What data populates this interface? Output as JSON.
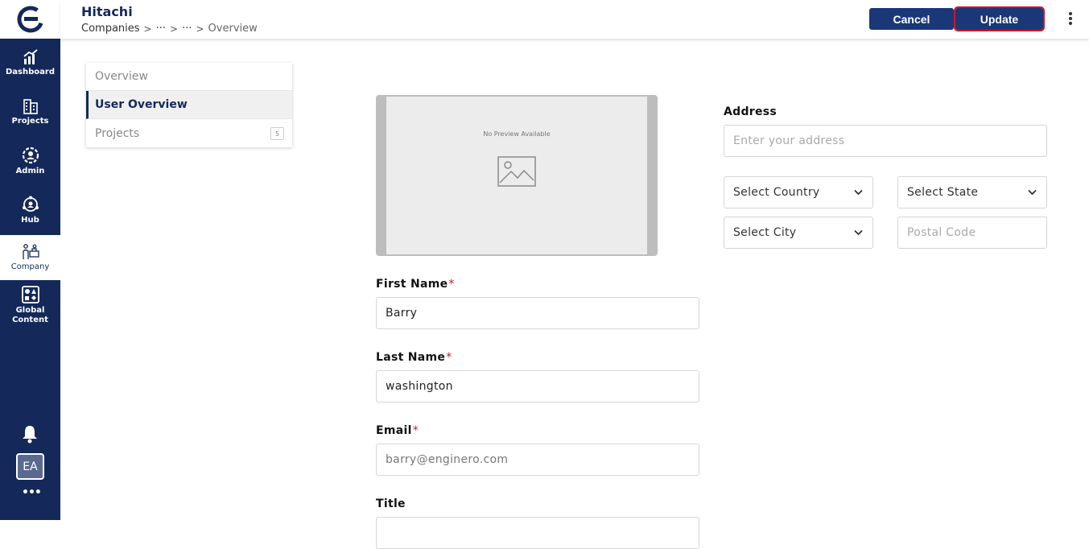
{
  "sidebar": {
    "items": [
      {
        "label": "Dashboard",
        "icon": "chart-icon"
      },
      {
        "label": "Projects",
        "icon": "building-icon"
      },
      {
        "label": "Admin",
        "icon": "admin-gear-icon"
      },
      {
        "label": "Hub",
        "icon": "hub-icon"
      },
      {
        "label": "Company",
        "icon": "company-people-icon"
      },
      {
        "label": "Global Content",
        "icon": "shapes-icon"
      }
    ],
    "avatar_initials": "EA",
    "more": "•••"
  },
  "header": {
    "title": "Hitachi",
    "breadcrumb": [
      "Companies",
      "···",
      "···",
      "Overview"
    ],
    "separator": ">",
    "cancel_label": "Cancel",
    "update_label": "Update"
  },
  "subnav": {
    "items": [
      {
        "label": "Overview"
      },
      {
        "label": "User Overview"
      },
      {
        "label": "Projects",
        "badge": "5"
      }
    ]
  },
  "preview": {
    "text": "No Preview Available"
  },
  "form": {
    "first_name": {
      "label": "First Name",
      "required": "*",
      "value": "Barry"
    },
    "last_name": {
      "label": "Last Name",
      "required": "*",
      "value": "washington"
    },
    "email": {
      "label": "Email",
      "required": "*",
      "value": "barry@enginero.com"
    },
    "title": {
      "label": "Title"
    },
    "address": {
      "label": "Address",
      "placeholder": "Enter your address"
    },
    "country": {
      "value": "Select Country"
    },
    "state": {
      "value": "Select State"
    },
    "city": {
      "value": "Select City"
    },
    "postal": {
      "placeholder": "Postal Code"
    }
  },
  "colors": {
    "brand": "#14285a",
    "button": "#1a3778",
    "highlight": "#d4141c"
  }
}
